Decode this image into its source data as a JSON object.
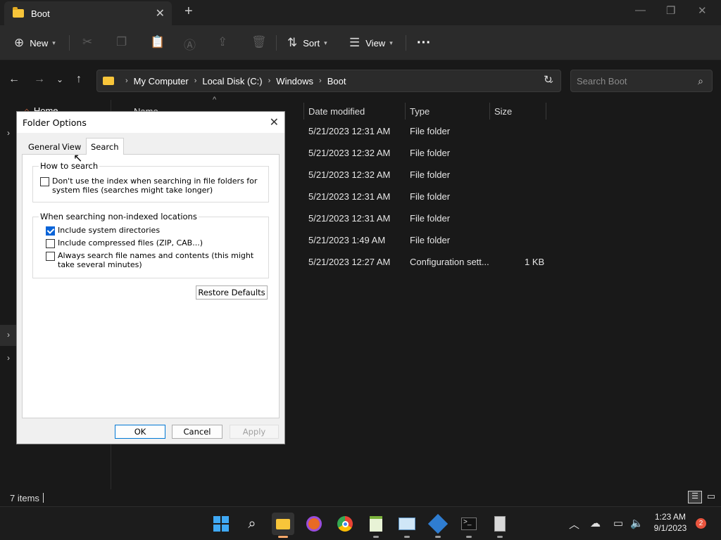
{
  "window": {
    "tab_title": "Boot",
    "new_tab": "+",
    "close_tab": "✕",
    "minimize": "—",
    "restore": "❐",
    "close": "✕"
  },
  "toolbar": {
    "new_label": "New",
    "sort_label": "Sort",
    "view_label": "View",
    "more": "···"
  },
  "address": {
    "crumbs": [
      "My Computer",
      "Local Disk (C:)",
      "Windows",
      "Boot"
    ],
    "search_placeholder": "Search Boot"
  },
  "navpane": {
    "home": "Home"
  },
  "columns": {
    "name": "Name",
    "date": "Date modified",
    "type": "Type",
    "size": "Size"
  },
  "files": [
    {
      "date": "5/21/2023 12:31 AM",
      "type": "File folder",
      "size": ""
    },
    {
      "date": "5/21/2023 12:32 AM",
      "type": "File folder",
      "size": ""
    },
    {
      "date": "5/21/2023 12:32 AM",
      "type": "File folder",
      "size": ""
    },
    {
      "date": "5/21/2023 12:31 AM",
      "type": "File folder",
      "size": ""
    },
    {
      "date": "5/21/2023 12:31 AM",
      "type": "File folder",
      "size": ""
    },
    {
      "date": "5/21/2023 1:49 AM",
      "type": "File folder",
      "size": ""
    },
    {
      "date": "5/21/2023 12:27 AM",
      "type": "Configuration sett...",
      "size": "1 KB"
    }
  ],
  "status": {
    "items": "7 items"
  },
  "dialog": {
    "title": "Folder Options",
    "tabs": [
      "General",
      "View",
      "Search"
    ],
    "active_tab": "Search",
    "group1_label": "How to search",
    "opt_no_index": "Don't use the index when searching in file folders for system files (searches might take longer)",
    "opt_no_index_checked": false,
    "group2_label": "When searching non-indexed locations",
    "opt_system_dirs": "Include system directories",
    "opt_system_dirs_checked": true,
    "opt_compressed": "Include compressed files (ZIP, CAB...)",
    "opt_compressed_checked": false,
    "opt_contents": "Always search file names and contents (this might take several minutes)",
    "opt_contents_checked": false,
    "restore_defaults": "Restore Defaults",
    "ok": "OK",
    "cancel": "Cancel",
    "apply": "Apply"
  },
  "taskbar": {
    "time": "1:23 AM",
    "date": "9/1/2023",
    "notification_count": "2"
  },
  "colors": {
    "accent": "#0078d4",
    "folder": "#f8c53a"
  }
}
